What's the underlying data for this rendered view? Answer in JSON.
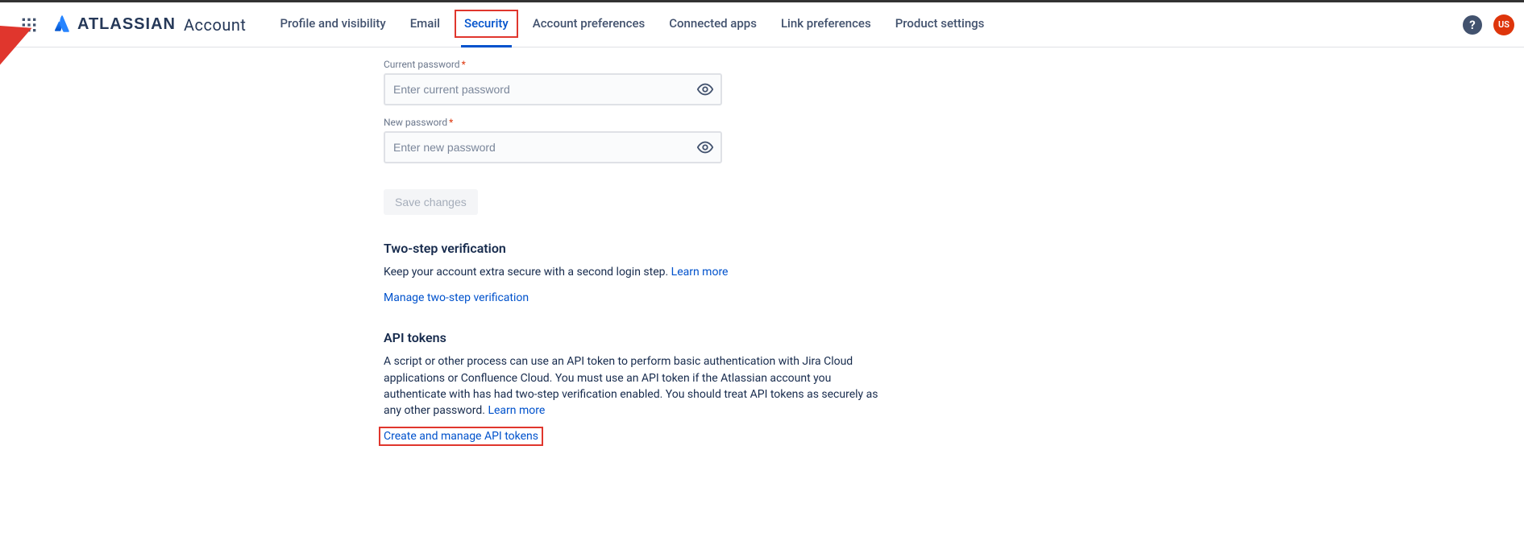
{
  "header": {
    "brand_text": "ATLASSIAN",
    "brand_sub": "Account",
    "tabs": [
      {
        "label": "Profile and visibility"
      },
      {
        "label": "Email"
      },
      {
        "label": "Security"
      },
      {
        "label": "Account preferences"
      },
      {
        "label": "Connected apps"
      },
      {
        "label": "Link preferences"
      },
      {
        "label": "Product settings"
      }
    ],
    "help_glyph": "?",
    "avatar_initials": "US"
  },
  "password_form": {
    "current_label": "Current password",
    "current_placeholder": "Enter current password",
    "new_label": "New password",
    "new_placeholder": "Enter new password",
    "save_label": "Save changes"
  },
  "twostep": {
    "heading": "Two-step verification",
    "body": "Keep your account extra secure with a second login step. ",
    "learn_more": "Learn more",
    "manage_link": "Manage two-step verification"
  },
  "api_tokens": {
    "heading": "API tokens",
    "body": "A script or other process can use an API token to perform basic authentication with Jira Cloud applications or Confluence Cloud. You must use an API token if the Atlassian account you authenticate with has had two-step verification enabled. You should treat API tokens as securely as any other password. ",
    "learn_more": "Learn more",
    "create_link": "Create and manage API tokens"
  }
}
